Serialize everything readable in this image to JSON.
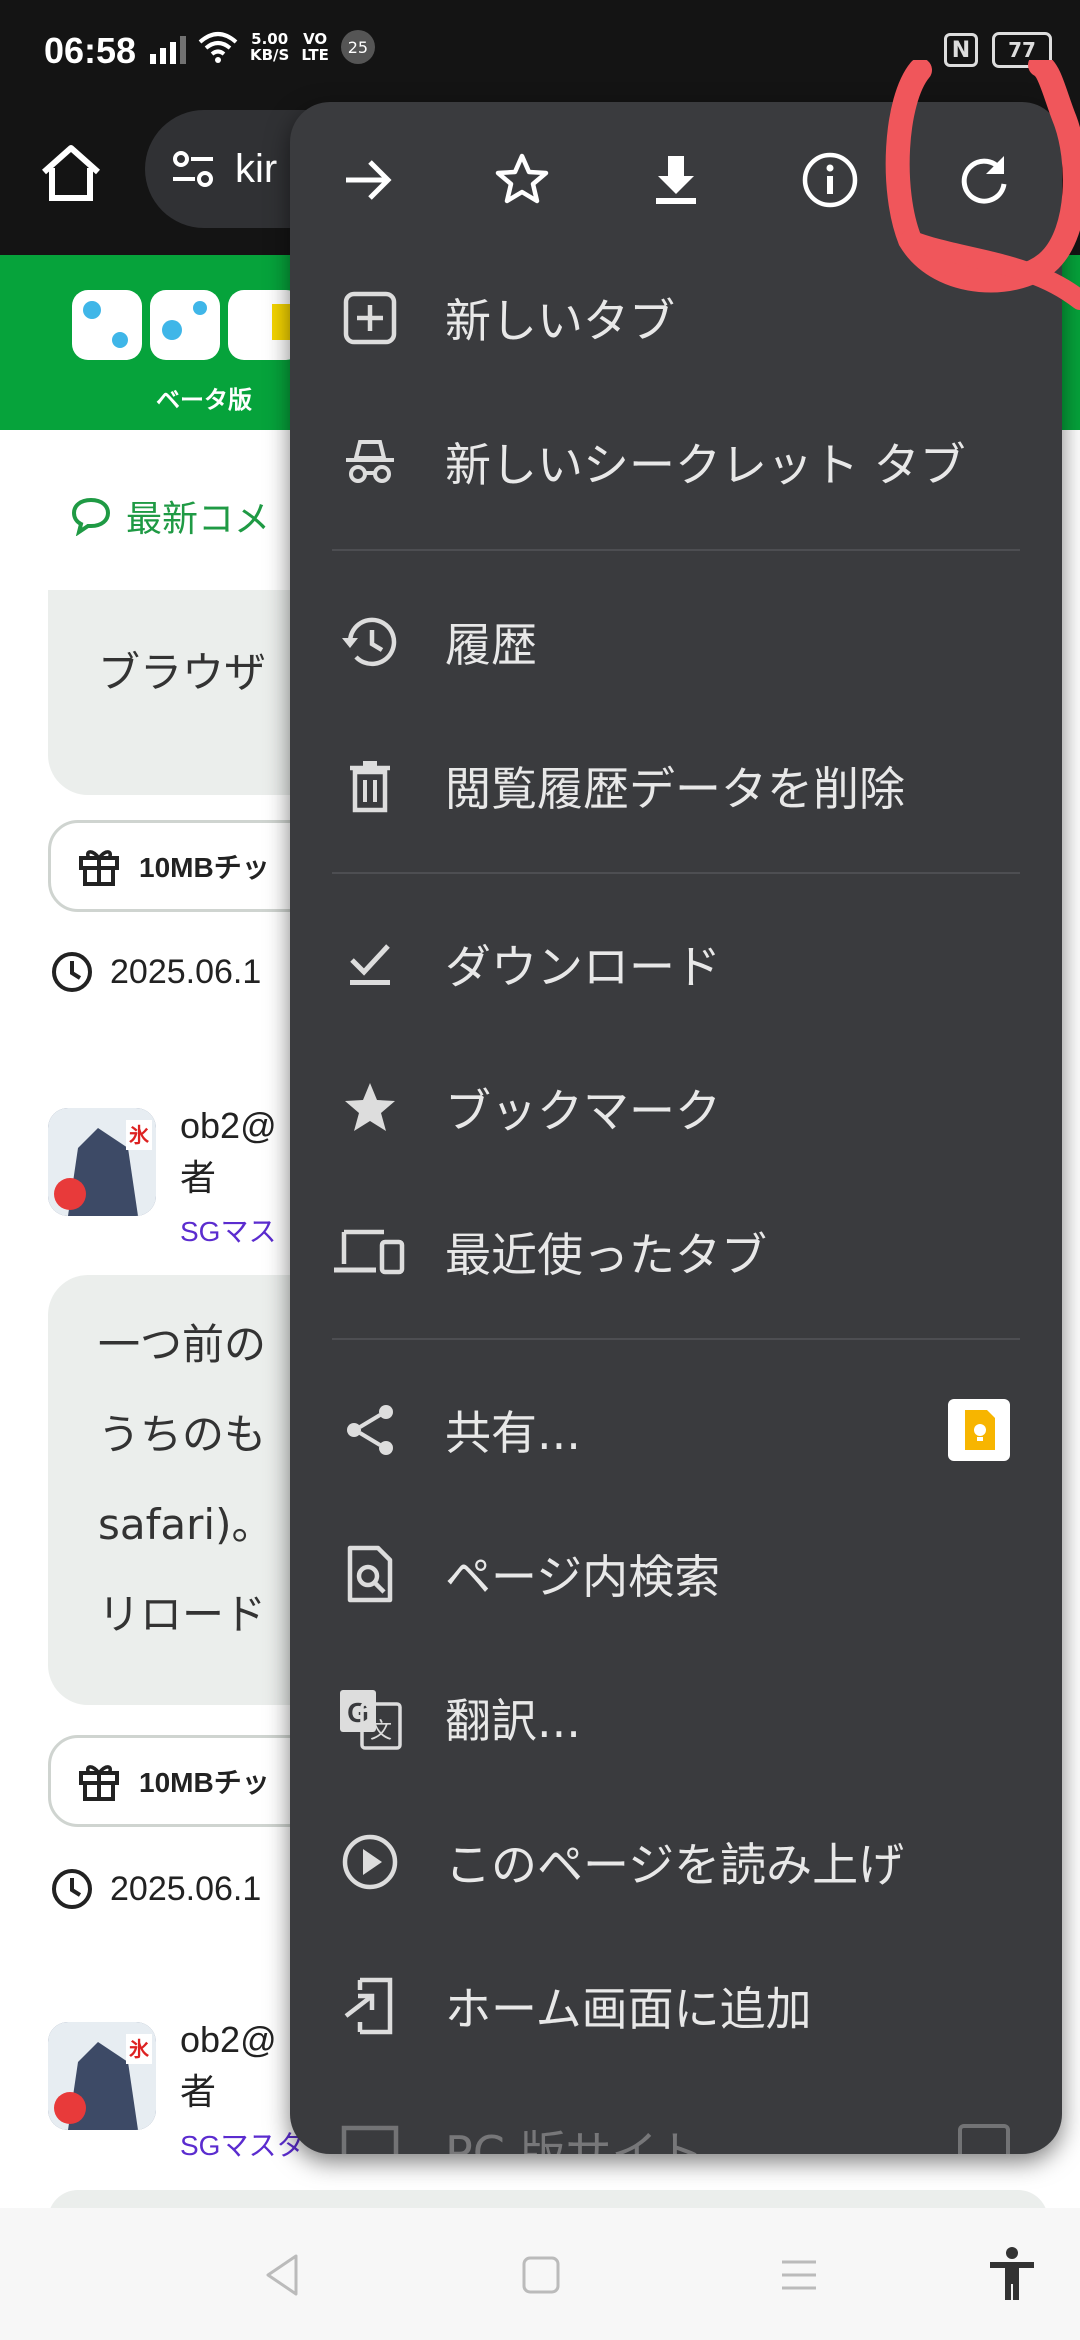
{
  "status_bar": {
    "time": "06:58",
    "net_speed_top": "5.00",
    "net_speed_bottom": "KB/S",
    "volte_top": "VO",
    "volte_bottom": "LTE",
    "notification_count": "25",
    "battery_level": "77"
  },
  "browser": {
    "url_text": "kir"
  },
  "site": {
    "beta_label": "ベータ版",
    "latest_comments_title": "最新コメ",
    "bubble1_text": "ブラウザ",
    "chip_label": "10MBチッ",
    "date_text": "2025.06.1",
    "comment_user_line1": "ob2@",
    "comment_user_line2": "者",
    "comment_user_role": "SGマス",
    "comment_lines": [
      "一つ前の",
      "うちのも",
      "safari)。",
      "リロード"
    ],
    "chip2_label": "10MBチッ",
    "date2_text": "2025.06.1",
    "comment2_user_line1": "ob2@",
    "comment2_user_line2": "者",
    "comment2_user_role": "SGマスタ"
  },
  "menu": {
    "top_actions": [
      {
        "name": "forward",
        "icon": "arrow-right-icon"
      },
      {
        "name": "bookmark",
        "icon": "star-outline-icon"
      },
      {
        "name": "download",
        "icon": "download-icon"
      },
      {
        "name": "page-info",
        "icon": "info-icon"
      },
      {
        "name": "reload",
        "icon": "reload-icon"
      }
    ],
    "items": [
      {
        "label": "新しいタブ",
        "icon": "plus-box-icon"
      },
      {
        "label": "新しいシークレット タブ",
        "icon": "incognito-icon"
      },
      {
        "label": "履歴",
        "icon": "history-icon"
      },
      {
        "label": "閲覧履歴データを削除",
        "icon": "trash-icon"
      },
      {
        "label": "ダウンロード",
        "icon": "download-done-icon"
      },
      {
        "label": "ブックマーク",
        "icon": "star-icon"
      },
      {
        "label": "最近使ったタブ",
        "icon": "devices-icon"
      },
      {
        "label": "共有...",
        "icon": "share-icon"
      },
      {
        "label": "ページ内検索",
        "icon": "find-in-page-icon"
      },
      {
        "label": "翻訳...",
        "icon": "translate-icon"
      },
      {
        "label": "このページを読み上げ",
        "icon": "play-circle-icon"
      },
      {
        "label": "ホーム画面に追加",
        "icon": "add-to-home-icon"
      },
      {
        "label": "PC 版サイト",
        "icon": "desktop-icon"
      }
    ]
  },
  "colors": {
    "menu_bg": "#3a3b3e",
    "site_green": "#06a33b",
    "annotation_red": "#f0565b"
  }
}
